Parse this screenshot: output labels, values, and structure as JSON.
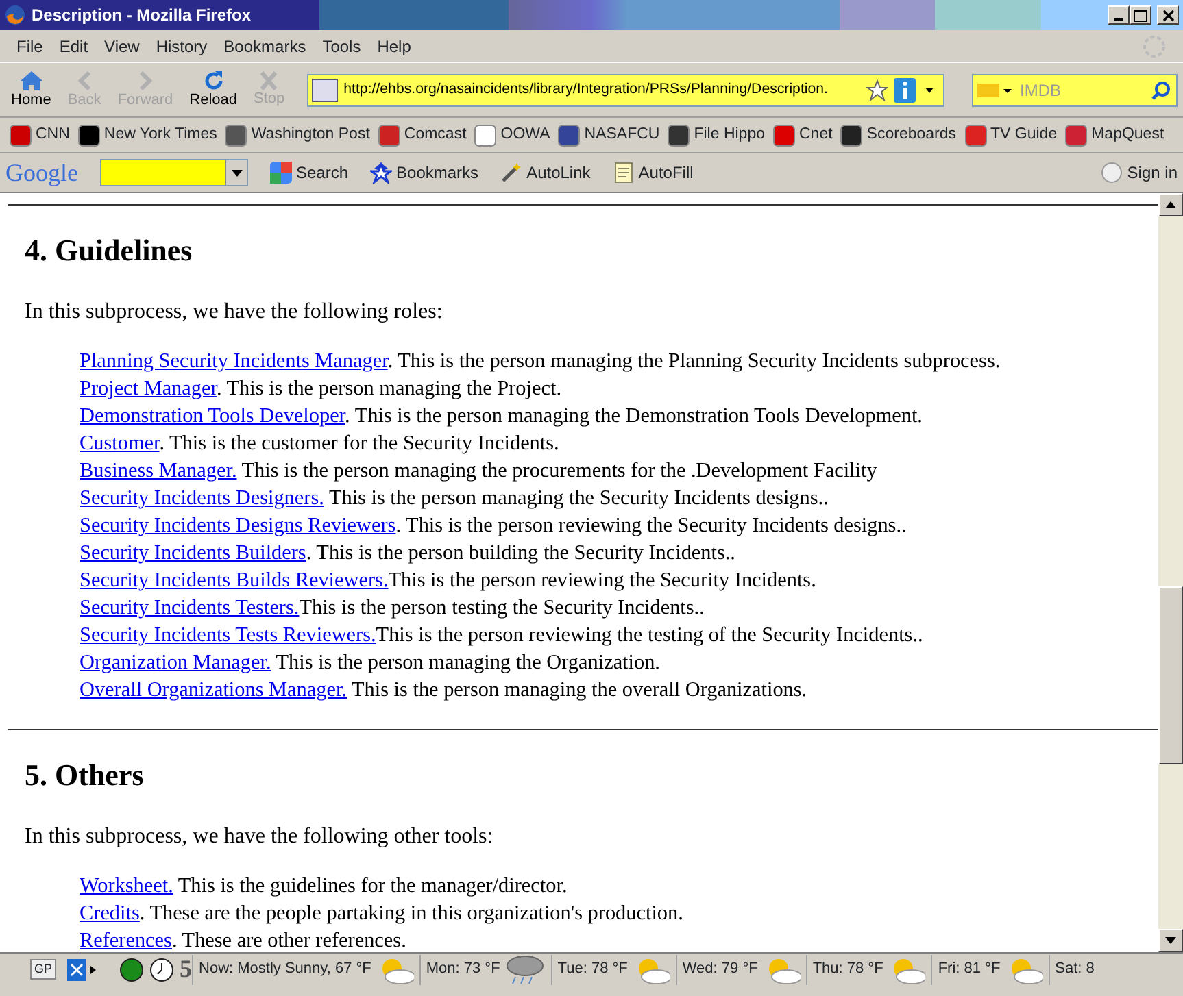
{
  "window": {
    "title": "Description - Mozilla Firefox"
  },
  "menu": [
    "File",
    "Edit",
    "View",
    "History",
    "Bookmarks",
    "Tools",
    "Help"
  ],
  "nav_buttons": [
    {
      "label": "Home",
      "kind": "home",
      "disabled": false
    },
    {
      "label": "Back",
      "kind": "back",
      "disabled": true
    },
    {
      "label": "Forward",
      "kind": "forward",
      "disabled": true
    },
    {
      "label": "Reload",
      "kind": "reload",
      "disabled": false
    },
    {
      "label": "Stop",
      "kind": "stop",
      "disabled": true
    }
  ],
  "address": {
    "value": "http://ehbs.org/nasaincidents/library/Integration/PRSs/Planning/Description."
  },
  "search": {
    "placeholder": "IMDB"
  },
  "bookmarks": [
    {
      "label": "CNN",
      "color": "#cc0000"
    },
    {
      "label": "New York Times",
      "color": "#000000"
    },
    {
      "label": "Washington Post",
      "color": "#555555"
    },
    {
      "label": "Comcast",
      "color": "#cc2222"
    },
    {
      "label": "OOWA",
      "color": "#ffffff"
    },
    {
      "label": "NASAFCU",
      "color": "#334499"
    },
    {
      "label": "File Hippo",
      "color": "#333333"
    },
    {
      "label": "Cnet",
      "color": "#dd0000"
    },
    {
      "label": "Scoreboards",
      "color": "#222222"
    },
    {
      "label": "TV Guide",
      "color": "#dd2222"
    },
    {
      "label": "MapQuest",
      "color": "#cc2233"
    }
  ],
  "google_toolbar": {
    "logo": "Google",
    "items": [
      {
        "label": "Search"
      },
      {
        "label": "Bookmarks"
      },
      {
        "label": "AutoLink"
      },
      {
        "label": "AutoFill"
      },
      {
        "label": "Sign in"
      }
    ]
  },
  "sections": [
    {
      "heading": "4. Guidelines",
      "intro": "In this subprocess, we have the following roles:",
      "items": [
        {
          "link": "Planning Security Incidents Manager",
          "text": ". This is the person managing the Planning Security Incidents subprocess."
        },
        {
          "link": "Project Manager",
          "text": ". This is the person managing the Project."
        },
        {
          "link": "Demonstration Tools Developer",
          "text": ". This is the person managing the Demonstration Tools Development."
        },
        {
          "link": "Customer",
          "text": ". This is the customer for the Security Incidents."
        },
        {
          "link": "Business Manager.",
          "text": " This is the person managing the procurements for the .Development Facility"
        },
        {
          "link": "Security Incidents Designers.",
          "text": " This is the person managing the Security Incidents designs.."
        },
        {
          "link": "Security Incidents Designs Reviewers",
          "text": ". This is the person reviewing the Security Incidents designs.."
        },
        {
          "link": "Security Incidents Builders",
          "text": ". This is the person building the Security Incidents.."
        },
        {
          "link": "Security Incidents Builds Reviewers.",
          "text": "This is the person reviewing the Security Incidents."
        },
        {
          "link": "Security Incidents Testers.",
          "text": "This is the person testing the Security Incidents.."
        },
        {
          "link": "Security Incidents Tests Reviewers.",
          "text": "This is the person reviewing the testing of the Security Incidents.."
        },
        {
          "link": "Organization Manager.",
          "text": " This is the person managing the Organization."
        },
        {
          "link": "Overall Organizations Manager.",
          "text": " This is the person managing the overall Organizations."
        }
      ]
    },
    {
      "heading": "5. Others",
      "intro": "In this subprocess, we have the following other tools:",
      "items": [
        {
          "link": "Worksheet.",
          "text": " This is the guidelines for the manager/director."
        },
        {
          "link": "Credits",
          "text": ". These are the people partaking in this organization's production."
        },
        {
          "link": "References",
          "text": ". These are other references."
        }
      ]
    }
  ],
  "status_bar": {
    "gp": "GP",
    "count": "5",
    "weather": [
      {
        "label": "Now: Mostly Sunny, 67 °F",
        "kind": "sun"
      },
      {
        "label": "Mon: 73 °F",
        "kind": "rain"
      },
      {
        "label": "Tue: 78 °F",
        "kind": "sun"
      },
      {
        "label": "Wed: 79 °F",
        "kind": "sun"
      },
      {
        "label": "Thu: 78 °F",
        "kind": "sun"
      },
      {
        "label": "Fri: 81 °F",
        "kind": "sun"
      },
      {
        "label": "Sat: 8",
        "kind": "none"
      }
    ]
  }
}
